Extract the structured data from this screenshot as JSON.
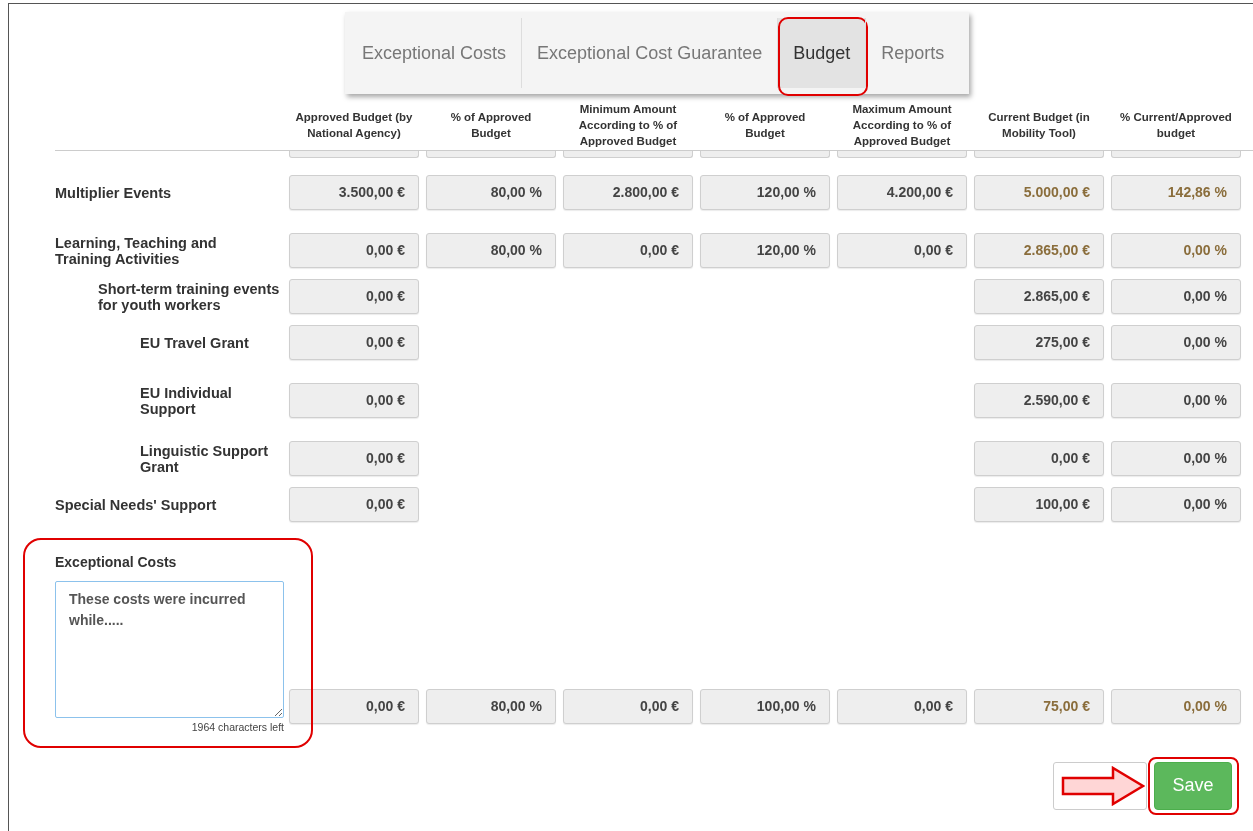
{
  "tabs": [
    {
      "label": "Exceptional Costs",
      "selected": false,
      "circled": false
    },
    {
      "label": "Exceptional Cost Guarantee",
      "selected": false,
      "circled": false
    },
    {
      "label": "Budget",
      "selected": true,
      "circled": true
    },
    {
      "label": "Reports",
      "selected": false,
      "circled": false
    }
  ],
  "columns": [
    "Approved Budget (by National Agency)",
    "% of Approved Budget",
    "Minimum Amount According to % of Approved Budget",
    "% of Approved Budget",
    "Maximum Amount According to % of Approved Budget",
    "Current Budget (in Mobility Tool)",
    "% Current/Approved budget"
  ],
  "rows": [
    {
      "label": "Multiplier Events",
      "highlighted": true,
      "cells": [
        "3.500,00 €",
        "80,00 %",
        "2.800,00 €",
        "120,00 %",
        "4.200,00 €",
        "5.000,00 €",
        "142,86 %"
      ]
    },
    {
      "label": "Learning, Teaching and Training Activities",
      "highlighted": true,
      "cells": [
        "0,00 €",
        "80,00 %",
        "0,00 €",
        "120,00 %",
        "0,00 €",
        "2.865,00 €",
        "0,00 %"
      ],
      "children": [
        {
          "label": "Short-term training events for youth workers",
          "highlighted": false,
          "cells": [
            "0,00 €",
            null,
            null,
            null,
            null,
            "2.865,00 €",
            "0,00 %"
          ],
          "children": [
            {
              "label": "EU Travel Grant",
              "highlighted": false,
              "cells": [
                "0,00 €",
                null,
                null,
                null,
                null,
                "275,00 €",
                "0,00 %"
              ]
            },
            {
              "label": "EU Individual Support",
              "highlighted": false,
              "cells": [
                "0,00 €",
                null,
                null,
                null,
                null,
                "2.590,00 €",
                "0,00 %"
              ]
            },
            {
              "label": "Linguistic Support Grant",
              "highlighted": false,
              "cells": [
                "0,00 €",
                null,
                null,
                null,
                null,
                "0,00 €",
                "0,00 %"
              ]
            }
          ]
        }
      ]
    },
    {
      "label": "Special Needs' Support",
      "highlighted": false,
      "cells": [
        "0,00 €",
        null,
        null,
        null,
        null,
        "100,00 €",
        "0,00 %"
      ]
    }
  ],
  "exceptional_costs": {
    "label": "Exceptional Costs",
    "value": "These costs were incurred while.....",
    "counter": "1964 characters left",
    "circled": true,
    "highlighted": true,
    "cells": [
      "0,00 €",
      "80,00 %",
      "0,00 €",
      "100,00 %",
      "0,00 €",
      "75,00 €",
      "0,00 %"
    ]
  },
  "buttons": [
    {
      "kind": "blank"
    },
    {
      "kind": "save",
      "label": "Save",
      "circled": true,
      "arrow": true
    }
  ]
}
